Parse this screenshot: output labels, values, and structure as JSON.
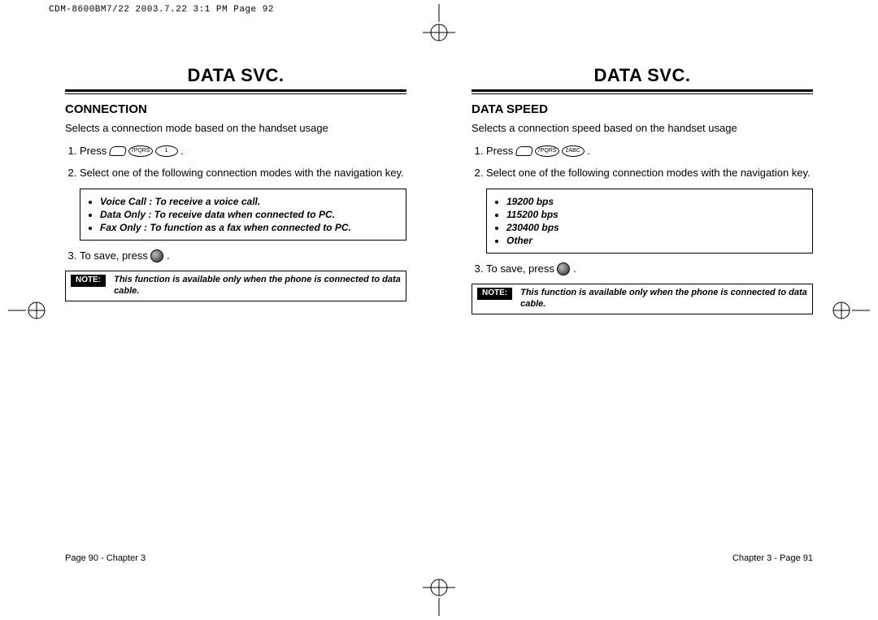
{
  "print_header": "CDM-8600BM7/22  2003.7.22  3:1 PM  Page 92",
  "left": {
    "page_title": "Data Svc.",
    "section_title": "Connection",
    "intro": "Selects a connection mode based on the handset usage",
    "step1_prefix": "Press",
    "step1_keys": [
      "menu",
      "7PQRS",
      "1"
    ],
    "step2": "Select one of the following connection modes with the navigation key.",
    "options": [
      "Voice Call : To receive a voice call.",
      "Data Only : To receive data when connected to PC.",
      "Fax Only : To function as a fax when connected to PC."
    ],
    "step3_prefix": "To save, press",
    "note_label": "NOTE:",
    "note_text": "This function is available only when the phone is connected to data cable.",
    "footer": "Page 90 - Chapter 3"
  },
  "right": {
    "page_title": "Data Svc.",
    "section_title": "Data Speed",
    "intro": "Selects a connection speed based on the handset usage",
    "step1_prefix": "Press",
    "step1_keys": [
      "menu",
      "7PQRS",
      "2ABC"
    ],
    "step2": "Select one of the following connection modes with the navigation key.",
    "options": [
      "19200 bps",
      "115200 bps",
      "230400 bps",
      "Other"
    ],
    "step3_prefix": "To save, press",
    "note_label": "NOTE:",
    "note_text": "This function is available only when the phone is connected to data cable.",
    "footer": "Chapter 3 - Page 91"
  }
}
